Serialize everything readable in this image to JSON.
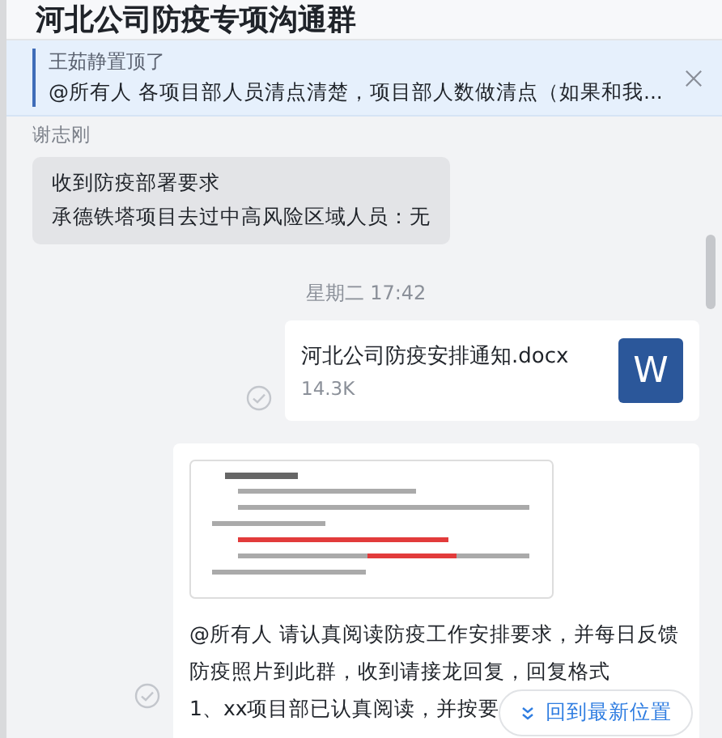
{
  "header": {
    "title": "河北公司防疫专项沟通群"
  },
  "pinned": {
    "by": "王茹静置顶了",
    "text": "@所有人  各项目部人员清点清楚，项目部人数做清点（如果和我..."
  },
  "messages": [
    {
      "kind": "text",
      "sender": "谢志刚",
      "lines": [
        "收到防疫部署要求",
        "承德铁塔项目去过中高风险区域人员：无"
      ]
    },
    {
      "kind": "time",
      "text": "星期二 17:42"
    },
    {
      "kind": "file",
      "name": "河北公司防疫安排通知.docx",
      "size": "14.3K",
      "badge": "W",
      "read": true
    },
    {
      "kind": "image_text",
      "image": {
        "kind": "picture"
      },
      "lines": [
        "@所有人  请认真阅读防疫工作安排要求，并每日反馈",
        "防疫照片到此群，收到请接龙回复，回复格式",
        "1、xx项目部已认真阅读，并按要"
      ],
      "read": true
    }
  ],
  "jump_button": "回到最新位置"
}
